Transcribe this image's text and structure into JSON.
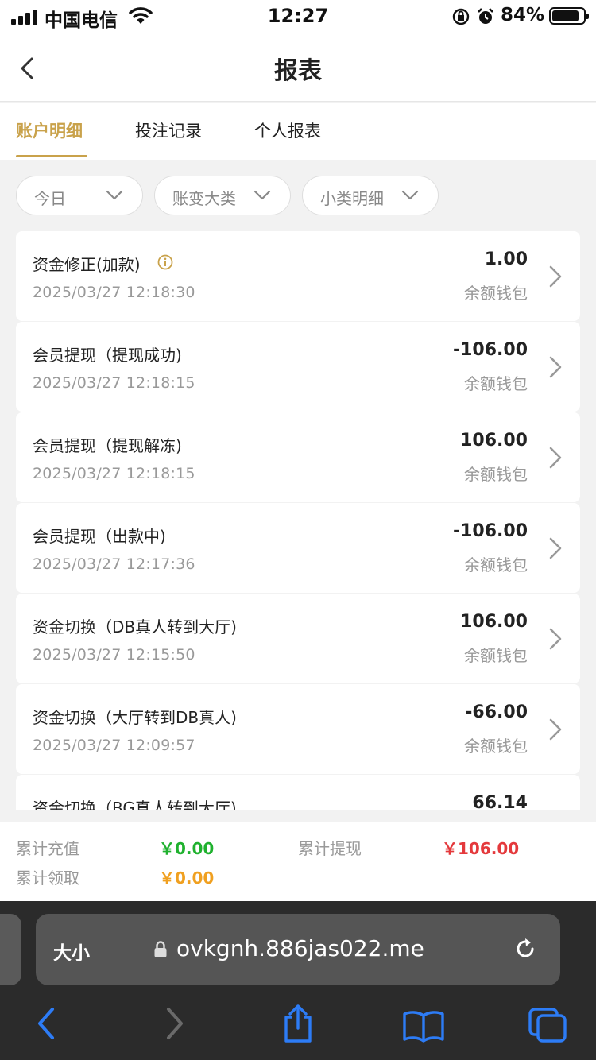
{
  "status_bar": {
    "carrier": "中国电信",
    "time": "12:27",
    "battery": "84%"
  },
  "header": {
    "title": "报表"
  },
  "tabs": [
    {
      "label": "账户明细",
      "active": true
    },
    {
      "label": "投注记录",
      "active": false
    },
    {
      "label": "个人报表",
      "active": false
    }
  ],
  "filters": [
    {
      "label": "今日"
    },
    {
      "label": "账变大类"
    },
    {
      "label": "小类明细"
    }
  ],
  "records": [
    {
      "title": "资金修正(加款)",
      "time": "2025/03/27 12:18:30",
      "amount": "1.00",
      "wallet": "余额钱包",
      "has_info": true
    },
    {
      "title": "会员提现（提现成功)",
      "time": "2025/03/27 12:18:15",
      "amount": "-106.00",
      "wallet": "余额钱包"
    },
    {
      "title": "会员提现（提现解冻)",
      "time": "2025/03/27 12:18:15",
      "amount": "106.00",
      "wallet": "余额钱包"
    },
    {
      "title": "会员提现（出款中)",
      "time": "2025/03/27 12:17:36",
      "amount": "-106.00",
      "wallet": "余额钱包"
    },
    {
      "title": "资金切换（DB真人转到大厅)",
      "time": "2025/03/27 12:15:50",
      "amount": "106.00",
      "wallet": "余额钱包"
    },
    {
      "title": "资金切换（大厅转到DB真人)",
      "time": "2025/03/27 12:09:57",
      "amount": "-66.00",
      "wallet": "余额钱包"
    },
    {
      "title": "资金切换（BG真人转到大厅)",
      "time": "",
      "amount": "66.14",
      "wallet": ""
    }
  ],
  "summary": {
    "recharge_label": "累计充值",
    "recharge_value": "￥0.00",
    "withdraw_label": "累计提现",
    "withdraw_value": "￥106.00",
    "claim_label": "累计领取",
    "claim_value": "￥0.00",
    "colors": {
      "recharge": "#1fb12e",
      "withdraw": "#e4393c",
      "claim": "#f0a020"
    }
  },
  "browser": {
    "text_size_label": "大小",
    "url": "ovkgnh.886jas022.me"
  },
  "colors": {
    "accent": "#c9a24b",
    "link_blue": "#2d7cf6"
  }
}
